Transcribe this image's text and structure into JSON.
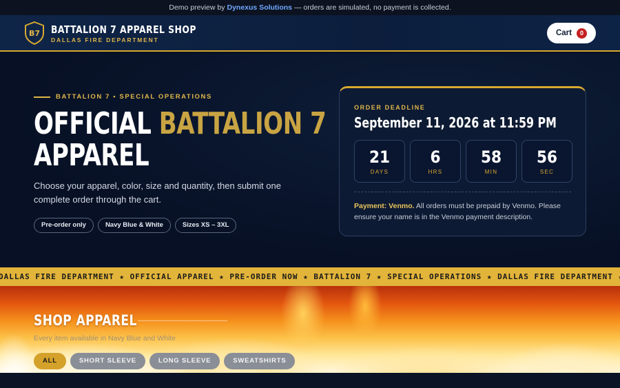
{
  "banner": {
    "prefix": "Demo preview by",
    "brand": "Dynexus Solutions",
    "suffix": "— orders are simulated, no payment is collected."
  },
  "header": {
    "logo_text": "B7",
    "title": "BATTALION 7 APPAREL SHOP",
    "subtitle": "DALLAS FIRE DEPARTMENT",
    "cart_label": "Cart",
    "cart_count": "0"
  },
  "hero": {
    "eyebrow": "BATTALION 7 • SPECIAL OPERATIONS",
    "title_part1": "OFFICIAL ",
    "title_gold": "BATTALION 7",
    "title_part2": "APPAREL",
    "description": "Choose your apparel, color, size and quantity, then submit one complete order through the cart.",
    "chips": [
      "Pre-order only",
      "Navy Blue & White",
      "Sizes XS – 3XL"
    ]
  },
  "deadline": {
    "label": "ORDER DEADLINE",
    "date": "September 11, 2026 at 11:59 PM",
    "countdown": [
      {
        "value": "21",
        "unit": "DAYS"
      },
      {
        "value": "6",
        "unit": "HRS"
      },
      {
        "value": "58",
        "unit": "MIN"
      },
      {
        "value": "56",
        "unit": "SEC"
      }
    ],
    "payment_strong": "Payment: Venmo.",
    "payment_text": " All orders must be prepaid by Venmo. Please ensure your name is in the Venmo payment description."
  },
  "ticker": {
    "text": "DALLAS FIRE DEPARTMENT ★ OFFICIAL APPAREL ★ PRE-ORDER NOW ★ BATTALION 7 ★ SPECIAL OPERATIONS ★ DALLAS FIRE DEPARTMENT ★ OFFICIAL APPAREL ★ PRE-ORDER NOW"
  },
  "shop": {
    "title": "SHOP APPAREL",
    "subtitle": "Every item available in Navy Blue and White",
    "filters": [
      "ALL",
      "SHORT SLEEVE",
      "LONG SLEEVE",
      "SWEATSHIRTS"
    ],
    "active_filter": "ALL"
  },
  "colors": {
    "gold": "#d9a92f",
    "navy": "#071024",
    "badge_red": "#c42121"
  }
}
